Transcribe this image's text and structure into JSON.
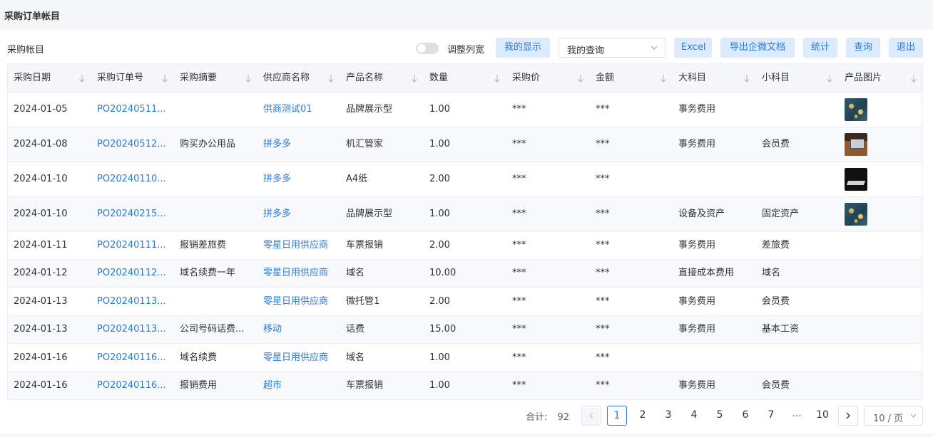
{
  "page": {
    "title": "采购订单帐目"
  },
  "toolbar": {
    "section_title": "采购帐目",
    "toggle_label": "调整列宽",
    "my_display": "我的显示",
    "query_select": "我的查询",
    "excel": "Excel",
    "export_wecom": "导出企微文档",
    "stats": "统计",
    "query": "查询",
    "exit": "退出"
  },
  "table": {
    "columns": [
      "采购日期",
      "采购订单号",
      "采购摘要",
      "供应商名称",
      "产品名称",
      "数量",
      "采购价",
      "金额",
      "大科目",
      "小科目",
      "产品图片"
    ],
    "rows": [
      {
        "date": "2024-01-05",
        "order": "PO20240511...",
        "summary": "",
        "supplier": "供商测试01",
        "product": "品牌展示型",
        "qty": "1.00",
        "price": "***",
        "amount": "***",
        "major": "事务费用",
        "minor": "",
        "image": "bokeh-image"
      },
      {
        "date": "2024-01-08",
        "order": "PO20240512...",
        "summary": "购买办公用品",
        "supplier": "拼多多",
        "product": "机汇管家",
        "qty": "1.00",
        "price": "***",
        "amount": "***",
        "major": "事务费用",
        "minor": "会员费",
        "image": "desk-laptop-image"
      },
      {
        "date": "2024-01-10",
        "order": "PO20240110...",
        "summary": "",
        "supplier": "拼多多",
        "product": "A4纸",
        "qty": "2.00",
        "price": "***",
        "amount": "***",
        "major": "",
        "minor": "",
        "image": "laptop-image"
      },
      {
        "date": "2024-01-10",
        "order": "PO20240215...",
        "summary": "",
        "supplier": "拼多多",
        "product": "品牌展示型",
        "qty": "1.00",
        "price": "***",
        "amount": "***",
        "major": "设备及资产",
        "minor": "固定资产",
        "image": "bokeh-image"
      },
      {
        "date": "2024-01-11",
        "order": "PO20240111...",
        "summary": "报销差旅费",
        "supplier": "零星日用供应商",
        "product": "车票报销",
        "qty": "2.00",
        "price": "***",
        "amount": "***",
        "major": "事务费用",
        "minor": "差旅费",
        "image": ""
      },
      {
        "date": "2024-01-12",
        "order": "PO20240112...",
        "summary": "域名续费一年",
        "supplier": "零星日用供应商",
        "product": "域名",
        "qty": "10.00",
        "price": "***",
        "amount": "***",
        "major": "直接成本费用",
        "minor": "域名",
        "image": ""
      },
      {
        "date": "2024-01-13",
        "order": "PO20240113...",
        "summary": "",
        "supplier": "零星日用供应商",
        "product": "微托管1",
        "qty": "2.00",
        "price": "***",
        "amount": "***",
        "major": "事务费用",
        "minor": "会员费",
        "image": ""
      },
      {
        "date": "2024-01-13",
        "order": "PO20240113...",
        "summary": "公司号码话费...",
        "supplier": "移动",
        "product": "话费",
        "qty": "15.00",
        "price": "***",
        "amount": "***",
        "major": "事务费用",
        "minor": "基本工资",
        "image": ""
      },
      {
        "date": "2024-01-16",
        "order": "PO20240116...",
        "summary": "域名续费",
        "supplier": "零星日用供应商",
        "product": "域名",
        "qty": "1.00",
        "price": "***",
        "amount": "***",
        "major": "",
        "minor": "",
        "image": ""
      },
      {
        "date": "2024-01-16",
        "order": "PO20240116...",
        "summary": "报销费用",
        "supplier": "超市",
        "product": "车票报销",
        "qty": "1.00",
        "price": "***",
        "amount": "***",
        "major": "事务费用",
        "minor": "会员费",
        "image": ""
      }
    ]
  },
  "pagination": {
    "total_label": "合计:",
    "total": "92",
    "pages": [
      "1",
      "2",
      "3",
      "4",
      "5",
      "6",
      "7",
      "...",
      "10"
    ],
    "current": "1",
    "page_size": "10 / 页",
    "prev_icon": "chevron-left-icon",
    "next_icon": "chevron-right-icon"
  },
  "colors": {
    "accent": "#2a7bd6",
    "button_bg": "#dbeafd",
    "header_bg": "#f5f7fa"
  }
}
